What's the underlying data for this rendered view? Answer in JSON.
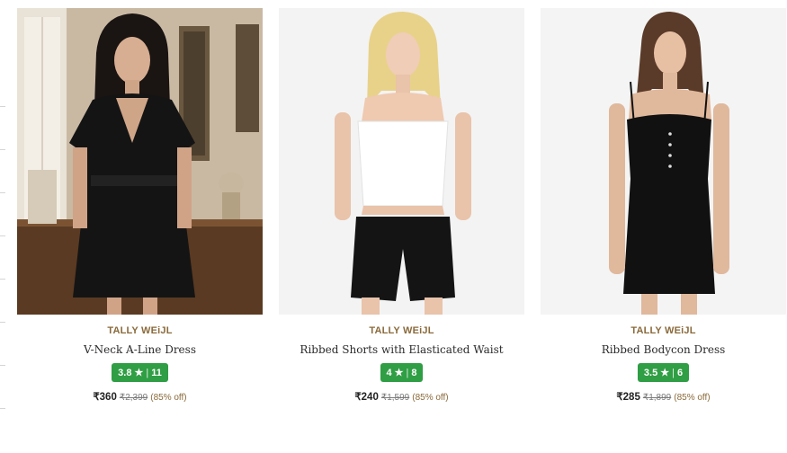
{
  "products": [
    {
      "brand": "TALLY WEiJL",
      "name": "V-Neck A-Line Dress",
      "rating": "3.8",
      "star": "★",
      "sep": "|",
      "reviews": "11",
      "price": "₹360",
      "mrp": "₹2,399",
      "discount": "(85% off)",
      "image": "woman-black-wrap-dress"
    },
    {
      "brand": "TALLY WEiJL",
      "name": "Ribbed Shorts with Elasticated Waist",
      "rating": "4",
      "star": "★",
      "sep": "|",
      "reviews": "8",
      "price": "₹240",
      "mrp": "₹1,599",
      "discount": "(85% off)",
      "image": "woman-white-top-black-shorts"
    },
    {
      "brand": "TALLY WEiJL",
      "name": "Ribbed Bodycon Dress",
      "rating": "3.5",
      "star": "★",
      "sep": "|",
      "reviews": "6",
      "price": "₹285",
      "mrp": "₹1,899",
      "discount": "(85% off)",
      "image": "woman-black-bodycon-dress"
    }
  ],
  "colors": {
    "brand": "#8a6a3b",
    "rating_badge": "#2f9e44",
    "mrp": "#7a7a7a"
  }
}
